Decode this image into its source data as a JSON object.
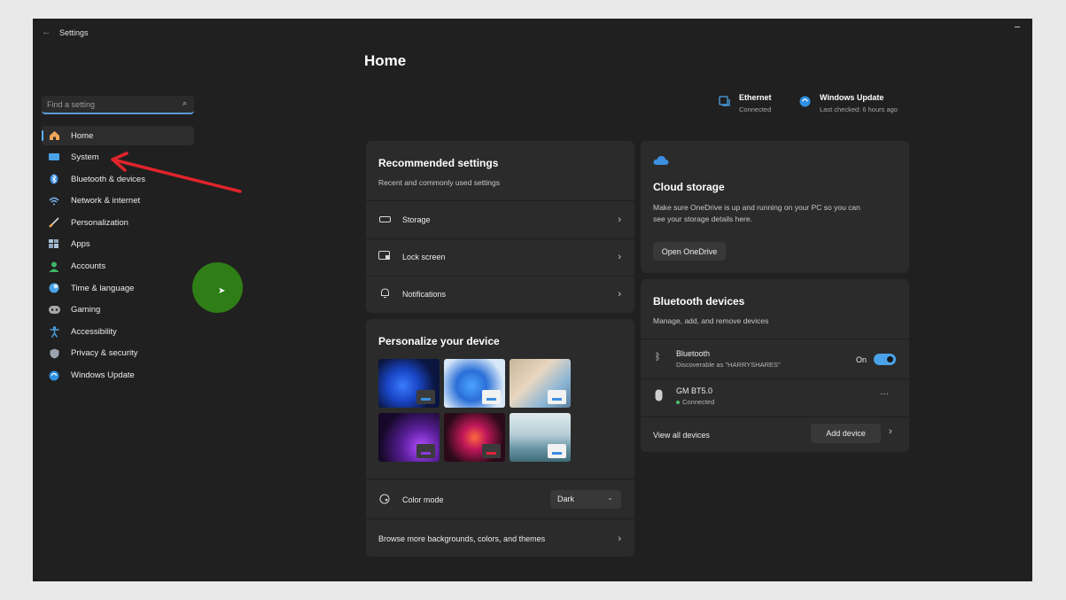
{
  "window": {
    "title": "Settings"
  },
  "search": {
    "placeholder": "Find a setting"
  },
  "sidebar": {
    "items": [
      {
        "label": "Home",
        "icon": "home-icon"
      },
      {
        "label": "System",
        "icon": "system-icon"
      },
      {
        "label": "Bluetooth & devices",
        "icon": "bluetooth-icon"
      },
      {
        "label": "Network & internet",
        "icon": "wifi-icon"
      },
      {
        "label": "Personalization",
        "icon": "brush-icon"
      },
      {
        "label": "Apps",
        "icon": "apps-icon"
      },
      {
        "label": "Accounts",
        "icon": "account-icon"
      },
      {
        "label": "Time & language",
        "icon": "globe-icon"
      },
      {
        "label": "Gaming",
        "icon": "gamepad-icon"
      },
      {
        "label": "Accessibility",
        "icon": "accessibility-icon"
      },
      {
        "label": "Privacy & security",
        "icon": "shield-icon"
      },
      {
        "label": "Windows Update",
        "icon": "update-icon"
      }
    ]
  },
  "page": {
    "title": "Home"
  },
  "status": {
    "ethernet": {
      "title": "Ethernet",
      "sub": "Connected"
    },
    "update": {
      "title": "Windows Update",
      "sub": "Last checked: 6 hours ago"
    }
  },
  "recommended": {
    "title": "Recommended settings",
    "subtitle": "Recent and commonly used settings",
    "rows": [
      {
        "label": "Storage"
      },
      {
        "label": "Lock screen"
      },
      {
        "label": "Notifications"
      }
    ]
  },
  "personalize": {
    "title": "Personalize your device",
    "color_mode_label": "Color mode",
    "color_mode_value": "Dark",
    "browse_label": "Browse more backgrounds, colors, and themes"
  },
  "cloud": {
    "title": "Cloud storage",
    "desc_line1": "Make sure OneDrive is up and running on your PC so you can",
    "desc_line2": "see your storage details here.",
    "button": "Open OneDrive"
  },
  "bluetooth_card": {
    "title": "Bluetooth devices",
    "subtitle": "Manage, add, and remove devices",
    "bt_name": "Bluetooth",
    "bt_sub": "Discoverable as \"HARRYSHARES\"",
    "bt_state": "On",
    "device_name": "GM BT5.0",
    "device_status": "Connected",
    "view_all": "View all devices",
    "add_device": "Add device"
  },
  "colors": {
    "accent": "#4aa3e8",
    "annotation": "#e0242b",
    "highlight": "#2e7d16"
  }
}
